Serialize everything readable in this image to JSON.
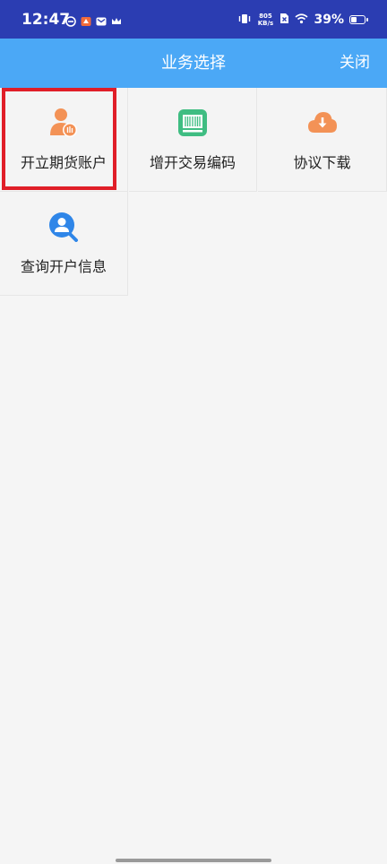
{
  "status_bar": {
    "time": "12:47",
    "net_speed_value": "805",
    "net_speed_unit": "KB/s",
    "battery_text": "39%",
    "battery_level": 0.39,
    "left_icons": [
      "sync-icon",
      "app-icon",
      "mail-icon",
      "crown-icon"
    ],
    "right_icons": [
      "vibrate-icon",
      "speed-indicator",
      "sim-off-icon",
      "wifi-icon",
      "battery-icon"
    ]
  },
  "header": {
    "title": "业务选择",
    "close_label": "关闭",
    "background": "#4ba8f6"
  },
  "grid": {
    "items": [
      {
        "label": "开立期货账户",
        "icon": "user-account-icon",
        "color": "#f39256"
      },
      {
        "label": "增开交易编码",
        "icon": "barcode-icon",
        "color": "#3fbd82"
      },
      {
        "label": "协议下载",
        "icon": "cloud-download-icon",
        "color": "#f39256"
      },
      {
        "label": "查询开户信息",
        "icon": "user-search-icon",
        "color": "#2f86e8"
      }
    ]
  },
  "highlight": {
    "color": "#e01e28",
    "target": "开立期货账户"
  }
}
